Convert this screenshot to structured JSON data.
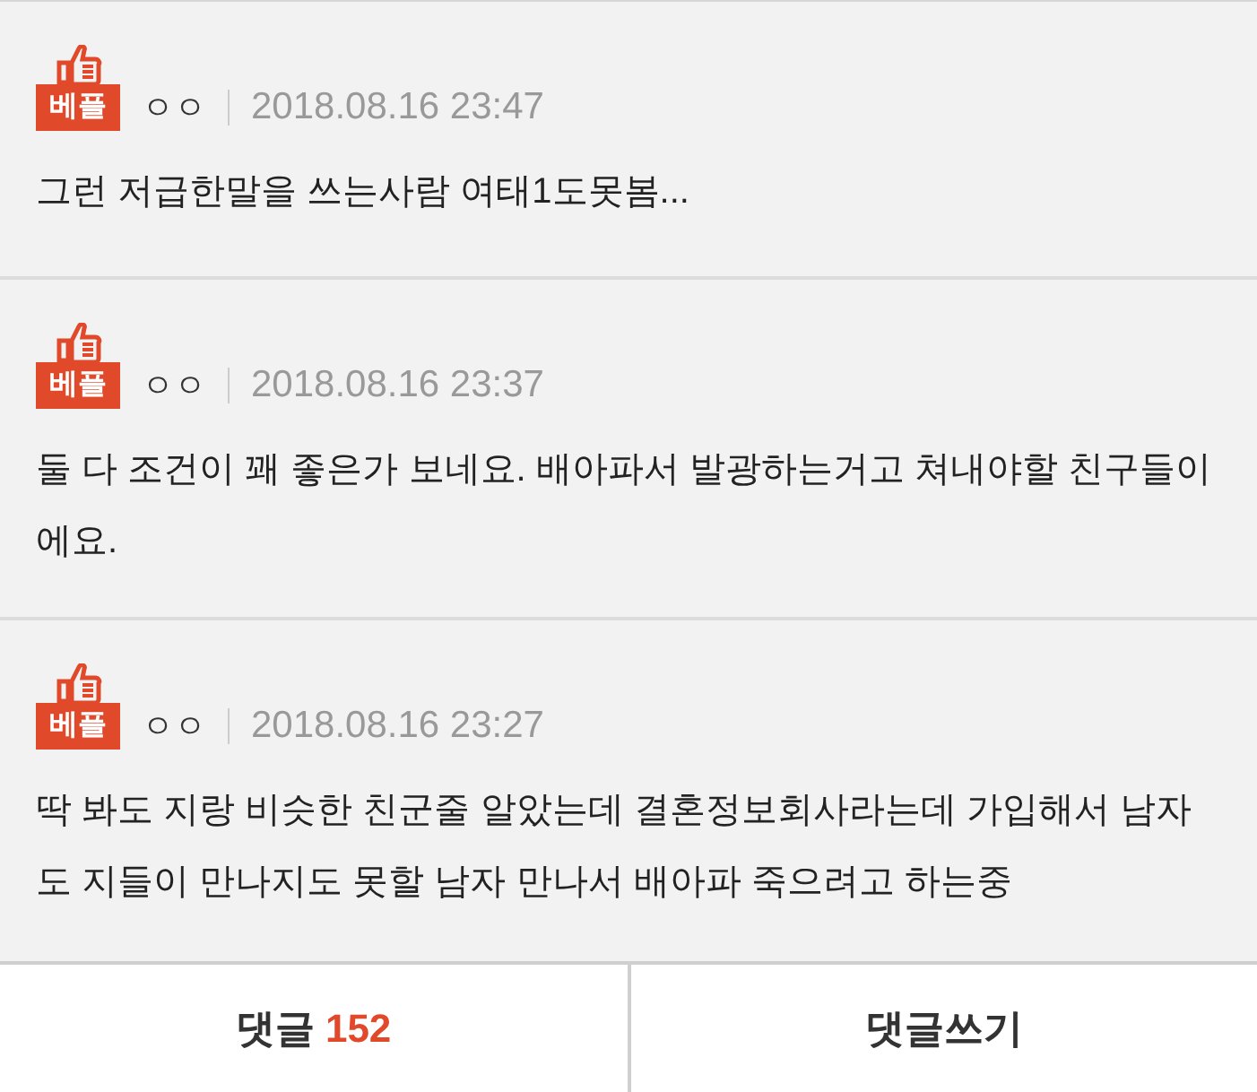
{
  "comments": [
    {
      "badge": "베플",
      "author": "ㅇㅇ",
      "time": "2018.08.16 23:47",
      "text": "그런 저급한말을 쓰는사람 여태1도못봄..."
    },
    {
      "badge": "베플",
      "author": "ㅇㅇ",
      "time": "2018.08.16 23:37",
      "text": "둘 다 조건이 꽤 좋은가 보네요. 배아파서 발광하는거고 쳐내야할 친구들이에요."
    },
    {
      "badge": "베플",
      "author": "ㅇㅇ",
      "time": "2018.08.16 23:27",
      "text": "딱 봐도 지랑 비슷한 친군줄 알았는데 결혼정보회사라는데 가입해서 남자도 지들이 만나지도 못할 남자 만나서 배아파 죽으려고 하는중"
    }
  ],
  "bottom_bar": {
    "comments_label": "댓글",
    "comments_count": "152",
    "write_label": "댓글쓰기"
  }
}
